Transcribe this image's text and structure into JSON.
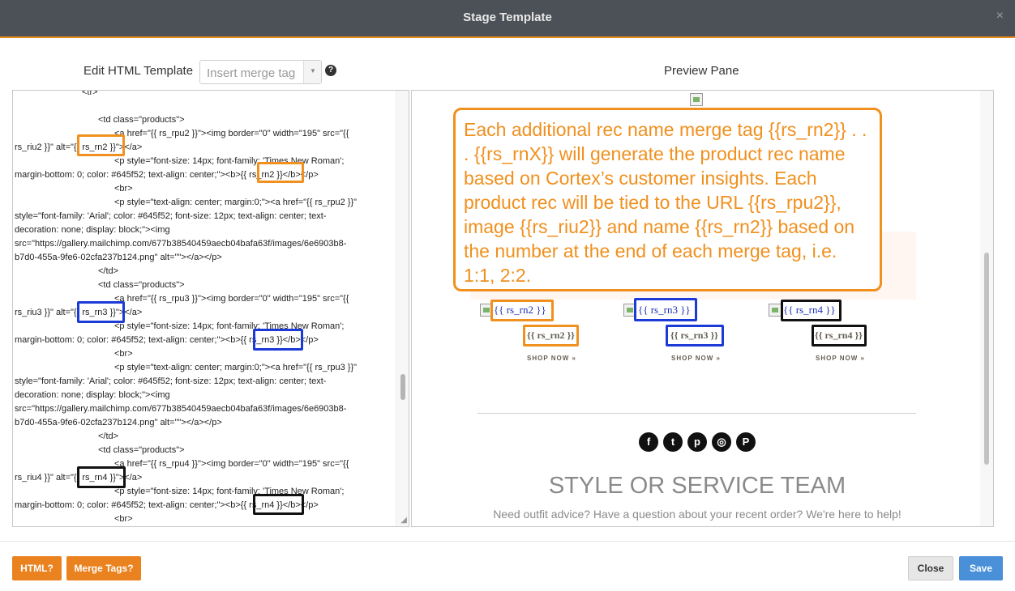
{
  "window": {
    "title": "Stage Template",
    "close_glyph": "×"
  },
  "editor": {
    "label": "Edit HTML Template",
    "merge_select": {
      "placeholder": "Insert merge tag",
      "arrow": "▼"
    },
    "help": "?",
    "lines": [
      "<tr>",
      "<td class=\"products\">",
      "<a href=\"{{ rs_rpu2 }}\"><img border=\"0\" width=\"195\" src=\"{{",
      "rs_riu2 }}\" alt=\"{{ rs_rn2 }}\"></a>",
      "<p style=\"font-size: 14px; font-family: 'Times New Roman';",
      "margin-bottom: 0; color: #645f52; text-align: center;\"><b>{{ rs_rn2 }}</b></p>",
      "<br>",
      "<p style=\"text-align: center; margin:0;\"><a href=\"{{ rs_rpu2 }}\"",
      "style=\"font-family: 'Arial'; color: #645f52; font-size: 12px; text-align: center; text-",
      "decoration: none; display: block;\"><img",
      "src=\"https://gallery.mailchimp.com/677b38540459aecb04bafa63f/images/6e6903b8-",
      "b7d0-455a-9fe6-02cfa237b124.png\" alt=\"\"></a></p>",
      "</td>",
      "<td class=\"products\">",
      "<a href=\"{{ rs_rpu3 }}\"><img border=\"0\" width=\"195\" src=\"{{",
      "rs_riu3 }}\" alt=\"{{ rs_rn3 }}\"></a>",
      "<p style=\"font-size: 14px; font-family: 'Times New Roman';",
      "margin-bottom: 0; color: #645f52; text-align: center;\"><b>{{ rs_rn3 }}</b></p>",
      "<br>",
      "<p style=\"text-align: center; margin:0;\"><a href=\"{{ rs_rpu3 }}\"",
      "style=\"font-family: 'Arial'; color: #645f52; font-size: 12px; text-align: center; text-",
      "decoration: none; display: block;\"><img",
      "src=\"https://gallery.mailchimp.com/677b38540459aecb04bafa63f/images/6e6903b8-",
      "b7d0-455a-9fe6-02cfa237b124.png\" alt=\"\"></a></p>",
      "</td>",
      "<td class=\"products\">",
      "<a href=\"{{ rs_rpu4 }}\"><img border=\"0\" width=\"195\" src=\"{{",
      "rs_riu4 }}\" alt=\"{{ rs_rn4 }}\"></a>",
      "<p style=\"font-size: 14px; font-family: 'Times New Roman';",
      "margin-bottom: 0; color: #645f52; text-align: center;\"><b>{{ rs_rn4 }}</b></p>",
      "<br>"
    ]
  },
  "preview": {
    "label": "Preview Pane",
    "callout": "Each additional rec name merge tag {{rs_rn2}} . . . {{rs_rnX}} will generate the product rec name based on Cortex’s customer insights. Each product rec will be tied to the URL {{rs_rpu2}}, image {{rs_riu2}} and name {{rs_rn2}} based on the number at the end of each merge tag, i.e. 1:1, 2:2.",
    "products": [
      {
        "name": "{{ rs_rn2 }}",
        "bold_name": "{{ rs_rn2 }}",
        "shop": "SHOP NOW »"
      },
      {
        "name": "{{ rs_rn3 }}",
        "bold_name": "{{ rs_rn3 }}",
        "shop": "SHOP NOW »"
      },
      {
        "name": "{{ rs_rn4 }}",
        "bold_name": "{{ rs_rn4 }}",
        "shop": "SHOP NOW »"
      }
    ],
    "social": [
      {
        "icon": "facebook-icon",
        "glyph": "f"
      },
      {
        "icon": "twitter-icon",
        "glyph": "t"
      },
      {
        "icon": "pinterest-icon",
        "glyph": "p"
      },
      {
        "icon": "instagram-icon",
        "glyph": "◎"
      },
      {
        "icon": "polyvore-icon",
        "glyph": "P"
      }
    ],
    "heading": "STYLE OR SERVICE TEAM",
    "subtext": "Need outfit advice? Have a question about your recent order? We're here to help!"
  },
  "footer": {
    "html_help": "HTML?",
    "merge_help": "Merge Tags?",
    "close": "Close",
    "save": "Save"
  },
  "colors": {
    "accent": "#e9821f",
    "title_bar": "#4c5158",
    "save": "#4a90d9",
    "tag_blue": "#1c3bd6",
    "product_text": "#645f52"
  }
}
